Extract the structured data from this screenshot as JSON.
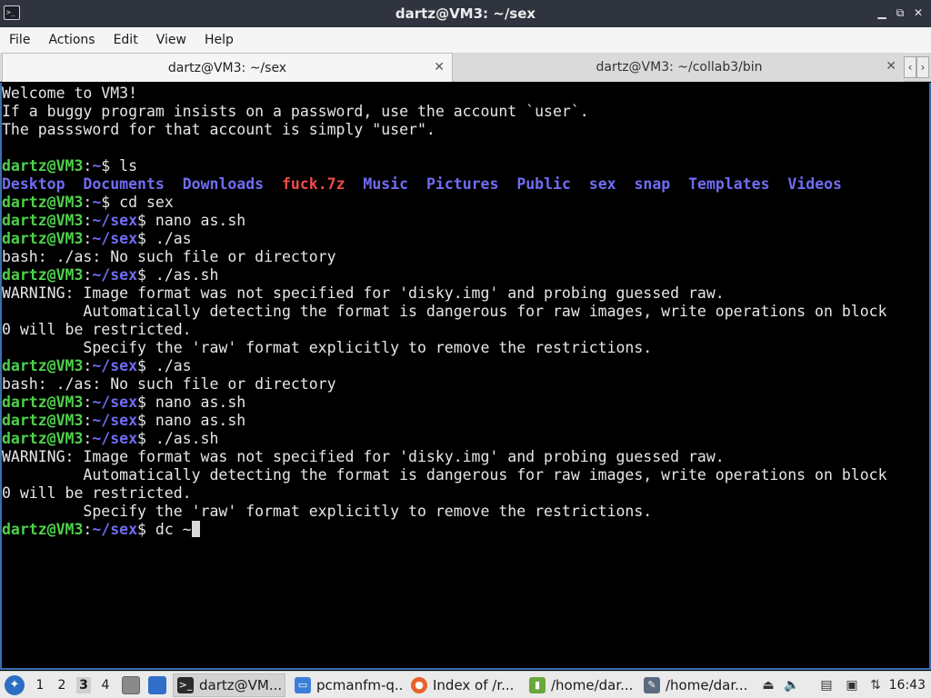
{
  "window": {
    "title": "dartz@VM3: ~/sex",
    "icon": "terminal-icon",
    "controls": [
      "minimize-icon",
      "restore-icon",
      "close-icon"
    ]
  },
  "menu": [
    "File",
    "Actions",
    "Edit",
    "View",
    "Help"
  ],
  "tabs": [
    {
      "label": "dartz@VM3: ~/sex",
      "active": true
    },
    {
      "label": "dartz@VM3: ~/collab3/bin",
      "active": false
    }
  ],
  "terminal": {
    "lines": [
      [
        {
          "t": "Welcome to VM3!",
          "c": "pc"
        }
      ],
      [
        {
          "t": "If a buggy program insists on a password, use the account `user`.",
          "c": "pc"
        }
      ],
      [
        {
          "t": "The passsword for that account is simply \"user\".",
          "c": "pc"
        }
      ],
      [
        {
          "t": "",
          "c": "pc"
        }
      ],
      [
        {
          "t": "dartz@VM3",
          "c": "pu"
        },
        {
          "t": ":",
          "c": "pc"
        },
        {
          "t": "~",
          "c": "pp"
        },
        {
          "t": "$ ls",
          "c": "pc"
        }
      ],
      [
        {
          "t": "Desktop",
          "c": "lsd"
        },
        {
          "t": "  ",
          "c": "pc"
        },
        {
          "t": "Documents",
          "c": "lsd"
        },
        {
          "t": "  ",
          "c": "pc"
        },
        {
          "t": "Downloads",
          "c": "lsd"
        },
        {
          "t": "  ",
          "c": "pc"
        },
        {
          "t": "fuck.7z",
          "c": "lsa"
        },
        {
          "t": "  ",
          "c": "pc"
        },
        {
          "t": "Music",
          "c": "lsd"
        },
        {
          "t": "  ",
          "c": "pc"
        },
        {
          "t": "Pictures",
          "c": "lsd"
        },
        {
          "t": "  ",
          "c": "pc"
        },
        {
          "t": "Public",
          "c": "lsd"
        },
        {
          "t": "  ",
          "c": "pc"
        },
        {
          "t": "sex",
          "c": "lsd"
        },
        {
          "t": "  ",
          "c": "pc"
        },
        {
          "t": "snap",
          "c": "lsd"
        },
        {
          "t": "  ",
          "c": "pc"
        },
        {
          "t": "Templates",
          "c": "lsd"
        },
        {
          "t": "  ",
          "c": "pc"
        },
        {
          "t": "Videos",
          "c": "lsd"
        }
      ],
      [
        {
          "t": "dartz@VM3",
          "c": "pu"
        },
        {
          "t": ":",
          "c": "pc"
        },
        {
          "t": "~",
          "c": "pp"
        },
        {
          "t": "$ cd sex",
          "c": "pc"
        }
      ],
      [
        {
          "t": "dartz@VM3",
          "c": "pu"
        },
        {
          "t": ":",
          "c": "pc"
        },
        {
          "t": "~/sex",
          "c": "pp"
        },
        {
          "t": "$ nano as.sh",
          "c": "pc"
        }
      ],
      [
        {
          "t": "dartz@VM3",
          "c": "pu"
        },
        {
          "t": ":",
          "c": "pc"
        },
        {
          "t": "~/sex",
          "c": "pp"
        },
        {
          "t": "$ ./as",
          "c": "pc"
        }
      ],
      [
        {
          "t": "bash: ./as: No such file or directory",
          "c": "pc"
        }
      ],
      [
        {
          "t": "dartz@VM3",
          "c": "pu"
        },
        {
          "t": ":",
          "c": "pc"
        },
        {
          "t": "~/sex",
          "c": "pp"
        },
        {
          "t": "$ ./as.sh",
          "c": "pc"
        }
      ],
      [
        {
          "t": "WARNING: Image format was not specified for 'disky.img' and probing guessed raw.",
          "c": "pc"
        }
      ],
      [
        {
          "t": "         Automatically detecting the format is dangerous for raw images, write operations on block",
          "c": "pc"
        }
      ],
      [
        {
          "t": "0 will be restricted.",
          "c": "pc"
        }
      ],
      [
        {
          "t": "         Specify the 'raw' format explicitly to remove the restrictions.",
          "c": "pc"
        }
      ],
      [
        {
          "t": "dartz@VM3",
          "c": "pu"
        },
        {
          "t": ":",
          "c": "pc"
        },
        {
          "t": "~/sex",
          "c": "pp"
        },
        {
          "t": "$ ./as",
          "c": "pc"
        }
      ],
      [
        {
          "t": "bash: ./as: No such file or directory",
          "c": "pc"
        }
      ],
      [
        {
          "t": "dartz@VM3",
          "c": "pu"
        },
        {
          "t": ":",
          "c": "pc"
        },
        {
          "t": "~/sex",
          "c": "pp"
        },
        {
          "t": "$ nano as.sh",
          "c": "pc"
        }
      ],
      [
        {
          "t": "dartz@VM3",
          "c": "pu"
        },
        {
          "t": ":",
          "c": "pc"
        },
        {
          "t": "~/sex",
          "c": "pp"
        },
        {
          "t": "$ nano as.sh",
          "c": "pc"
        }
      ],
      [
        {
          "t": "dartz@VM3",
          "c": "pu"
        },
        {
          "t": ":",
          "c": "pc"
        },
        {
          "t": "~/sex",
          "c": "pp"
        },
        {
          "t": "$ ./as.sh",
          "c": "pc"
        }
      ],
      [
        {
          "t": "WARNING: Image format was not specified for 'disky.img' and probing guessed raw.",
          "c": "pc"
        }
      ],
      [
        {
          "t": "         Automatically detecting the format is dangerous for raw images, write operations on block",
          "c": "pc"
        }
      ],
      [
        {
          "t": "0 will be restricted.",
          "c": "pc"
        }
      ],
      [
        {
          "t": "         Specify the 'raw' format explicitly to remove the restrictions.",
          "c": "pc"
        }
      ],
      [
        {
          "t": "dartz@VM3",
          "c": "pu"
        },
        {
          "t": ":",
          "c": "pc"
        },
        {
          "t": "~/sex",
          "c": "pp"
        },
        {
          "t": "$ dc ~",
          "c": "pc"
        }
      ]
    ],
    "colors": {
      "user": "#4ed14a",
      "path": "#6f6cf2",
      "archive": "#f04b4b",
      "text": "#e6e6e6"
    }
  },
  "taskbar": {
    "start_icon": "lxqt-start-icon",
    "workspaces": [
      "1",
      "2",
      "3",
      "4"
    ],
    "active_workspace": "3",
    "quick_icons": [
      "file-manager-icon",
      "show-desktop-icon"
    ],
    "tasks": [
      {
        "label": "dartz@VM...",
        "icon": "terminal-icon",
        "active": true
      },
      {
        "label": "pcmanfm-q...",
        "icon": "folder-icon",
        "active": false
      },
      {
        "label": "Index of /r...",
        "icon": "firefox-icon",
        "active": false
      },
      {
        "label": "/home/dar...",
        "icon": "archive-icon",
        "active": false
      },
      {
        "label": "/home/dar...",
        "icon": "editor-icon",
        "active": false
      }
    ],
    "tray_icons": [
      "eject-icon",
      "volume-icon",
      "clipboard-icon",
      "display-icon",
      "network-icon"
    ],
    "clock": "16:43"
  }
}
